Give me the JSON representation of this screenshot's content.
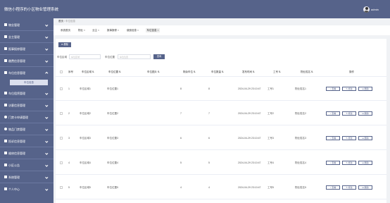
{
  "header": {
    "title": "微信小程序的小区物业管理系统",
    "username": "admin"
  },
  "sidebar": {
    "items": [
      {
        "label": "物业管理"
      },
      {
        "label": "业主管理"
      },
      {
        "label": "报事报修管理"
      },
      {
        "label": "缴费信息管理"
      },
      {
        "label": "车位信息管理"
      },
      {
        "label": "车位租赁管理"
      },
      {
        "label": "访客信息管理"
      },
      {
        "label": "门禁卡申请管理"
      },
      {
        "label": "物品门禁管理"
      },
      {
        "label": "投诉信息管理"
      },
      {
        "label": "维修信息管理"
      },
      {
        "label": "小区公告"
      },
      {
        "label": "系统管理"
      },
      {
        "label": "个人中心"
      }
    ],
    "active_sub": "车位信息"
  },
  "breadcrumb": {
    "home": "首页",
    "current": "车位信息"
  },
  "tabs": [
    {
      "label": "系统首页"
    },
    {
      "label": "物业"
    },
    {
      "label": "业主"
    },
    {
      "label": "报事报修"
    },
    {
      "label": "缴费信息"
    },
    {
      "label": "车位信息",
      "active": true
    }
  ],
  "toolbar": {
    "delete_label": "删除"
  },
  "search": {
    "label1": "车位区域",
    "placeholder1": "车位区域",
    "label2": "车位位置",
    "placeholder2": "车位位置",
    "query_label": "查询"
  },
  "table": {
    "columns": [
      "序号",
      "车位区域",
      "车位位置",
      "车位图片",
      "剩余车位",
      "车位数量",
      "发布时间",
      "工号",
      "物业姓名",
      "操作"
    ],
    "actions": [
      "查看",
      "修改",
      "删除"
    ],
    "rows": [
      {
        "no": "1",
        "area": "车位区域1",
        "pos": "车位位置1",
        "remain": "8",
        "total": "8",
        "time": "2024-04-29 23:10:47",
        "job": "工号1",
        "name": "物业姓名1",
        "img": "barrier"
      },
      {
        "no": "2",
        "area": "车位区域2",
        "pos": "车位位置2",
        "remain": "7",
        "total": "7",
        "time": "2024-04-29 23:10:47",
        "job": "工号2",
        "name": "物业姓名2",
        "img": "grid"
      },
      {
        "no": "3",
        "area": "车位区域3",
        "pos": "车位位置3",
        "remain": "6",
        "total": "6",
        "time": "2024-04-29 23:10:47",
        "job": "工号3",
        "name": "物业姓名3",
        "img": "dark"
      },
      {
        "no": "4",
        "area": "车位区域4",
        "pos": "车位位置4",
        "remain": "5",
        "total": "5",
        "time": "2024-04-29 23:10:47",
        "job": "工号4",
        "name": "物业姓名4",
        "img": "yellow"
      },
      {
        "no": "5",
        "area": "车位区域5",
        "pos": "车位位置5",
        "remain": "4",
        "total": "4",
        "time": "2024-04-29 23:10:47",
        "job": "工号5",
        "name": "物业姓名5",
        "img": "green"
      }
    ]
  }
}
